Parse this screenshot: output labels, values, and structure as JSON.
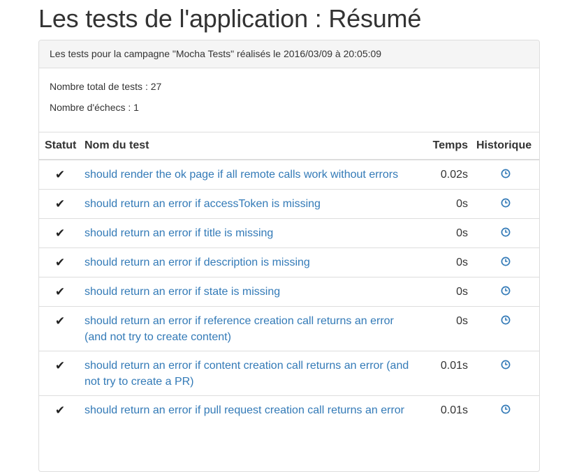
{
  "page": {
    "title": "Les tests de l'application : Résumé"
  },
  "panel": {
    "heading": "Les tests pour la campagne \"Mocha Tests\" réalisés le 2016/03/09 à 20:05:09",
    "total_tests": "Nombre total de tests : 27",
    "failures": "Nombre d'échecs : 1"
  },
  "table": {
    "headers": {
      "status": "Statut",
      "name": "Nom du test",
      "time": "Temps",
      "history": "Historique"
    },
    "rows": [
      {
        "status_icon": "check-icon",
        "name": "should render the ok page if all remote calls work without errors",
        "time": "0.02s",
        "history_icon": "clock-icon"
      },
      {
        "status_icon": "check-icon",
        "name": "should return an error if accessToken is missing",
        "time": "0s",
        "history_icon": "clock-icon"
      },
      {
        "status_icon": "check-icon",
        "name": "should return an error if title is missing",
        "time": "0s",
        "history_icon": "clock-icon"
      },
      {
        "status_icon": "check-icon",
        "name": "should return an error if description is missing",
        "time": "0s",
        "history_icon": "clock-icon"
      },
      {
        "status_icon": "check-icon",
        "name": "should return an error if state is missing",
        "time": "0s",
        "history_icon": "clock-icon"
      },
      {
        "status_icon": "check-icon",
        "name": "should return an error if reference creation call returns an error (and not try to create content)",
        "time": "0s",
        "history_icon": "clock-icon"
      },
      {
        "status_icon": "check-icon",
        "name": "should return an error if content creation call returns an error (and not try to create a PR)",
        "time": "0.01s",
        "history_icon": "clock-icon"
      },
      {
        "status_icon": "check-icon",
        "name": "should return an error if pull request creation call returns an error",
        "time": "0.01s",
        "history_icon": "clock-icon"
      }
    ]
  },
  "colors": {
    "link": "#337ab7",
    "border": "#dddddd",
    "heading_bg": "#f5f5f5"
  }
}
